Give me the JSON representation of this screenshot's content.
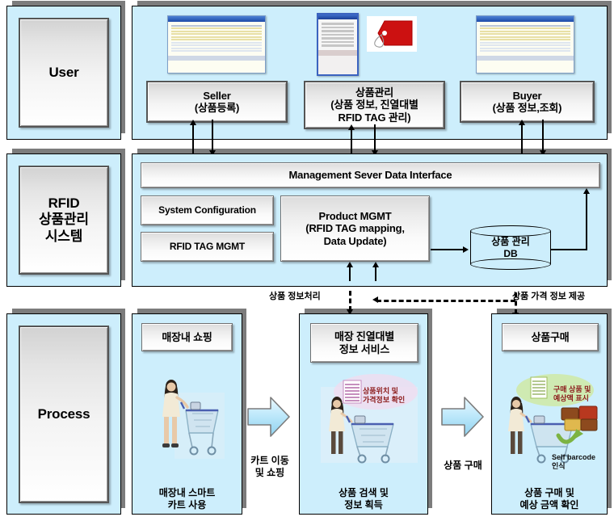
{
  "layers": {
    "user": {
      "title": "User",
      "boxes": [
        {
          "id": "seller",
          "line1": "Seller",
          "line2": "(상품등록)"
        },
        {
          "id": "product-mgmt",
          "line1": "상품관리",
          "line2": "(상품 정보, 진열대별",
          "line3": "RFID TAG 관리)"
        },
        {
          "id": "buyer",
          "line1": "Buyer",
          "line2": "(상품 정보,조회)"
        }
      ],
      "thumbnails": [
        {
          "id": "seller-app-window",
          "kind": "desktop-window"
        },
        {
          "id": "pda-app-window",
          "kind": "pda-window"
        },
        {
          "id": "rfid-price-tag",
          "kind": "price-tag"
        },
        {
          "id": "buyer-app-window",
          "kind": "desktop-window"
        }
      ]
    },
    "system": {
      "title_line1": "RFID",
      "title_line2": "상품관리",
      "title_line3": "시스템",
      "interface": "Management Sever Data Interface",
      "modules": [
        {
          "id": "system-configuration",
          "label": "System Configuration"
        },
        {
          "id": "rfid-tag-mgmt",
          "label": "RFID TAG MGMT"
        }
      ],
      "product_mgmt": {
        "line1": "Product MGMT",
        "line2": "(RFID TAG mapping,",
        "line3": "Data Update)"
      },
      "database": {
        "line1": "상품 관리",
        "line2": "DB"
      }
    },
    "process": {
      "title": "Process",
      "steps": [
        {
          "id": "in-store-shopping",
          "header": "매장내 쇼핑",
          "caption": "매장내 스마트\n카트 사용"
        },
        {
          "id": "shelf-info-service",
          "header": "매장 진열대별\n정보 서비스",
          "caption": "상품 검색 및\n정보 획득",
          "note_red": "상품위치 및\n가격정보 확인"
        },
        {
          "id": "product-purchase",
          "header": "상품구매",
          "caption": "상품 구매 및\n예상 금액 확인",
          "note_red": "구매 상품 및\n예상액 표시",
          "note_dark": "Self barcode\n인식"
        }
      ],
      "arrows": [
        {
          "id": "cart-move-arrow",
          "label": "카트 이동\n및 쇼핑"
        },
        {
          "id": "purchase-arrow",
          "label": "상품 구매"
        }
      ]
    },
    "connector_labels": [
      {
        "id": "product-info-process",
        "label": "상품 정보처리"
      },
      {
        "id": "product-price-info",
        "label": "상품 가격 정보 제공"
      }
    ]
  },
  "colors": {
    "panel_bg": "#cdeefc",
    "panel_border": "#000000",
    "panel_shadow": "#7c7c7c",
    "note_red": "#8c1b1b",
    "tag_red": "#cc1111",
    "arrow_fill": "#bfe9fb"
  }
}
